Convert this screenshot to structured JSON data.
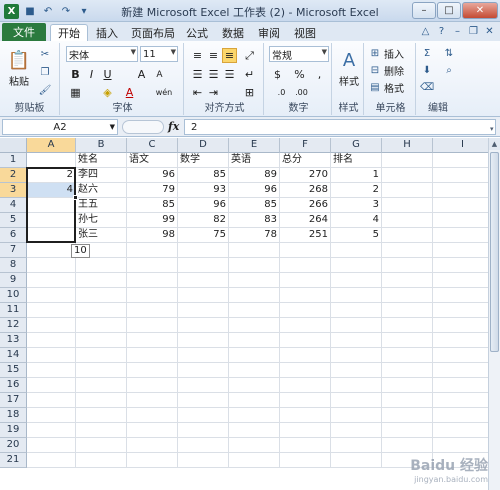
{
  "window": {
    "title": "新建 Microsoft Excel 工作表 (2) - Microsoft Excel",
    "logo": "X",
    "controls": {
      "minimize": "–",
      "maximize": "□",
      "close": "✕"
    }
  },
  "ribbon_tabs": {
    "file": "文件",
    "items": [
      "开始",
      "插入",
      "页面布局",
      "公式",
      "数据",
      "审阅",
      "视图"
    ],
    "active": "开始"
  },
  "ribbon": {
    "clipboard": {
      "label": "剪贴板",
      "paste": "粘贴"
    },
    "font": {
      "label": "字体",
      "name": "宋体",
      "size": "11",
      "bold": "B",
      "italic": "I",
      "underline": "U",
      "grow": "A",
      "shrink": "A",
      "wen": "wén"
    },
    "alignment": {
      "label": "对齐方式"
    },
    "number": {
      "label": "数字",
      "format": "常规"
    },
    "styles": {
      "label": "样式",
      "button": "样式"
    },
    "cells": {
      "label": "单元格",
      "insert": "插入",
      "delete": "删除",
      "format": "格式"
    },
    "editing": {
      "label": "编辑",
      "sum": "Σ"
    },
    "accent_color": "#2b7a3e"
  },
  "formula_bar": {
    "name_box": "A2",
    "fx": "fx",
    "value": "2"
  },
  "grid": {
    "columns": [
      "A",
      "B",
      "C",
      "D",
      "E",
      "F",
      "G",
      "H",
      "I"
    ],
    "selected_column": "A",
    "rows": [
      "1",
      "2",
      "3",
      "4",
      "5",
      "6",
      "7",
      "8",
      "9",
      "10",
      "11",
      "12",
      "13",
      "14",
      "15",
      "16",
      "17",
      "18",
      "19",
      "20",
      "21"
    ],
    "selected_rows": [
      "2",
      "3"
    ],
    "cells": [
      [
        "",
        "姓名",
        "语文",
        "数学",
        "英语",
        "总分",
        "排名",
        "",
        ""
      ],
      [
        "2",
        "李四",
        "96",
        "85",
        "89",
        "270",
        "1",
        "",
        ""
      ],
      [
        "4",
        "赵六",
        "79",
        "93",
        "96",
        "268",
        "2",
        "",
        ""
      ],
      [
        "",
        "王五",
        "85",
        "96",
        "85",
        "266",
        "3",
        "",
        ""
      ],
      [
        "",
        "孙七",
        "99",
        "82",
        "83",
        "264",
        "4",
        "",
        ""
      ],
      [
        "",
        "张三",
        "98",
        "75",
        "78",
        "251",
        "5",
        "",
        ""
      ]
    ],
    "autofill_tip": "10"
  },
  "watermark": {
    "text": "Baidu 经验",
    "sub": "jingyan.baidu.com"
  }
}
